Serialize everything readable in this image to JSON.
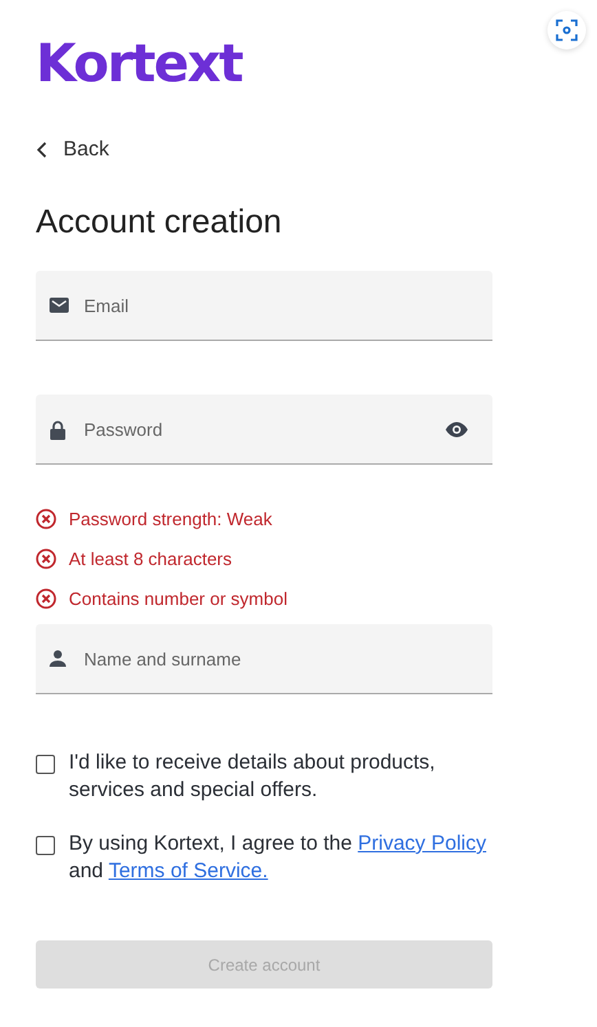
{
  "logo": "Kortext",
  "back": {
    "label": "Back"
  },
  "title": "Account creation",
  "fields": [
    {
      "kind": "email",
      "placeholder": "Email"
    },
    {
      "kind": "password",
      "placeholder": "Password",
      "reveal": true
    },
    {
      "kind": "name",
      "placeholder": "Name and surname"
    }
  ],
  "password_rules": [
    {
      "text": "Password strength: Weak",
      "met": false
    },
    {
      "text": "At least 8 characters",
      "met": false
    },
    {
      "text": "Contains number or symbol",
      "met": false
    }
  ],
  "consents": [
    {
      "checked": false,
      "parts": [
        {
          "kind": "text",
          "text": "I'd like to receive details about products, services and special offers."
        }
      ]
    },
    {
      "checked": false,
      "parts": [
        {
          "kind": "text",
          "text": "By using Kortext, I agree to the"
        },
        {
          "kind": "link",
          "text": "Privacy Policy"
        },
        {
          "kind": "text",
          "text": "and"
        },
        {
          "kind": "link",
          "text": "Terms of Service."
        }
      ]
    }
  ],
  "submit": {
    "label": "Create account",
    "disabled": true
  }
}
